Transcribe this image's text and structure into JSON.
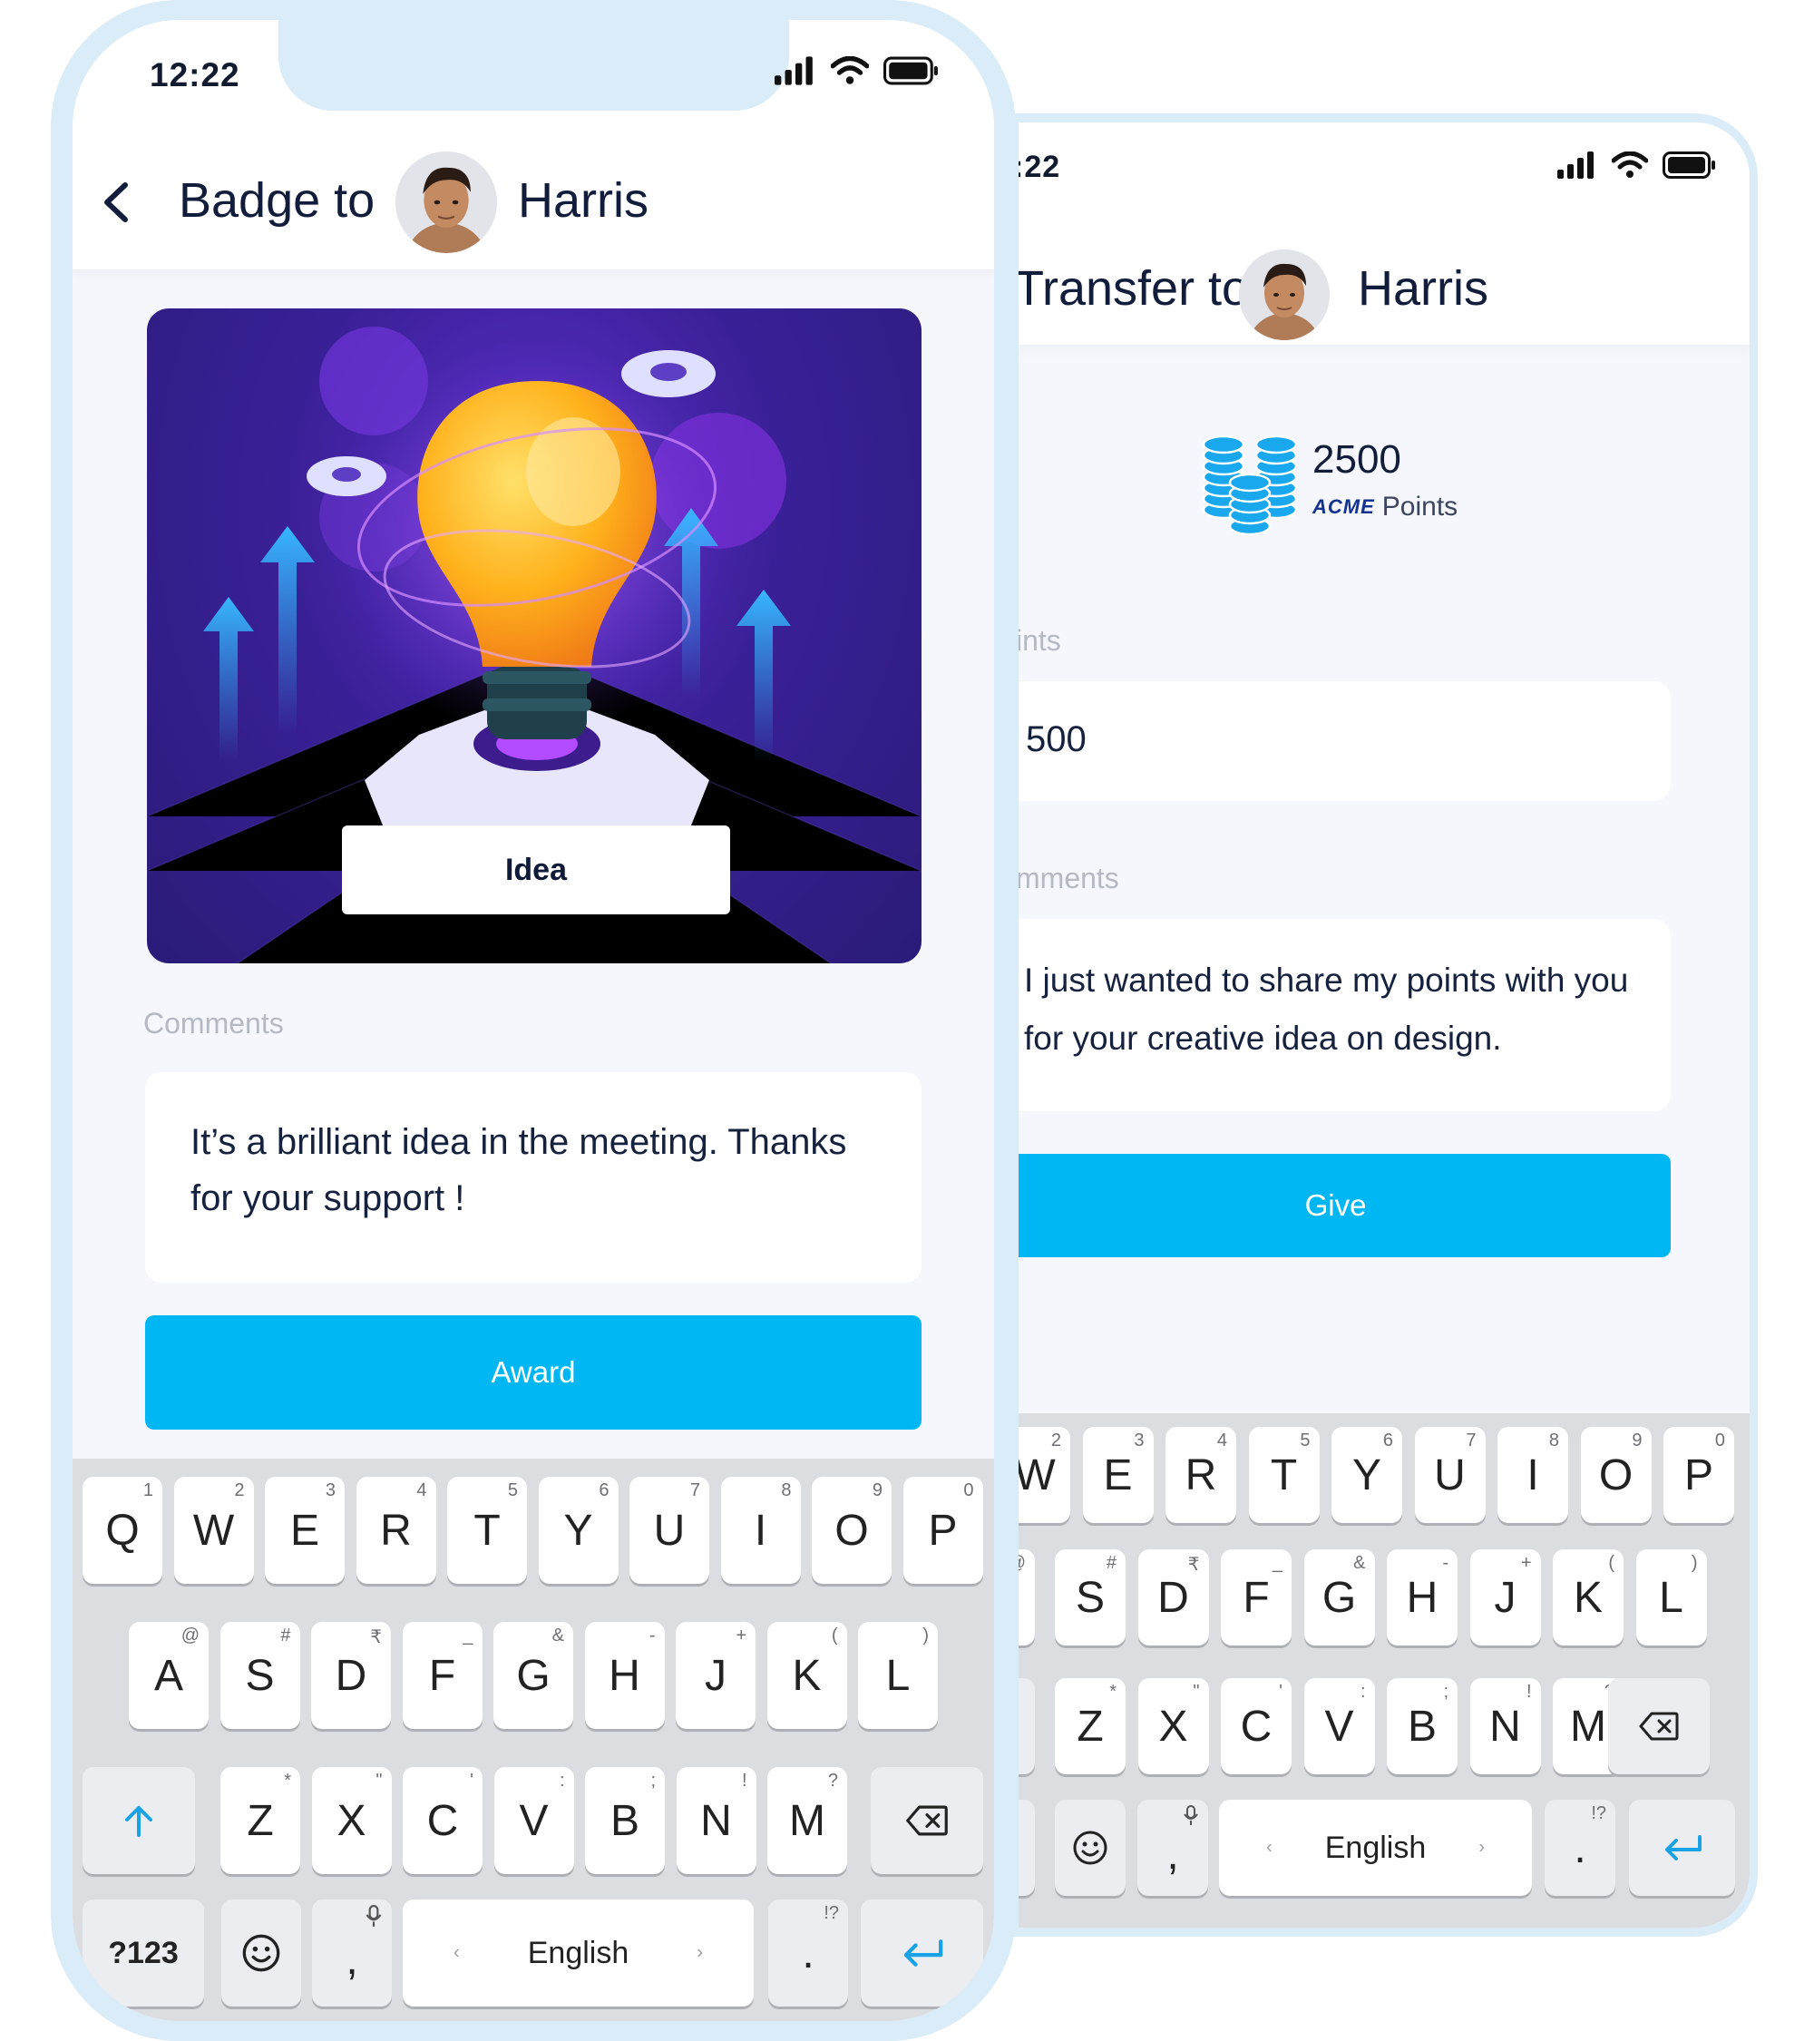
{
  "back_screen": {
    "status_time": ":22",
    "title": "Transfer to",
    "recipient_name": "Harris",
    "balance": {
      "amount": "2500",
      "brand": "ACME",
      "unit": "Points"
    },
    "points_label": "ints",
    "points_value": "500",
    "comments_label": "mments",
    "comment_lines": [
      "I just wanted to share my points with you",
      "for  your creative idea on design."
    ],
    "give_label": "Give",
    "keyboard": {
      "row1": [
        {
          "k": "W",
          "h": "2"
        },
        {
          "k": "E",
          "h": "3"
        },
        {
          "k": "R",
          "h": "4"
        },
        {
          "k": "T",
          "h": "5"
        },
        {
          "k": "Y",
          "h": "6"
        },
        {
          "k": "U",
          "h": "7"
        },
        {
          "k": "I",
          "h": "8"
        },
        {
          "k": "O",
          "h": "9"
        },
        {
          "k": "P",
          "h": "0"
        }
      ],
      "row2": [
        {
          "k": "S",
          "h": "#"
        },
        {
          "k": "D",
          "h": "₹"
        },
        {
          "k": "F",
          "h": "_"
        },
        {
          "k": "G",
          "h": "&"
        },
        {
          "k": "H",
          "h": "-"
        },
        {
          "k": "J",
          "h": "+"
        },
        {
          "k": "K",
          "h": "("
        },
        {
          "k": "L",
          "h": ")"
        }
      ],
      "row2_partial_hint": "@",
      "row3": [
        {
          "k": "Z",
          "h": "*"
        },
        {
          "k": "X",
          "h": "\""
        },
        {
          "k": "C",
          "h": "'"
        },
        {
          "k": "V",
          "h": ":"
        },
        {
          "k": "B",
          "h": ";"
        },
        {
          "k": "N",
          "h": "!"
        },
        {
          "k": "M",
          "h": "?"
        }
      ],
      "comma": ",",
      "period": ".",
      "period_hint": "!?",
      "space_label": "English"
    }
  },
  "front_screen": {
    "status_time": "12:22",
    "title": "Badge to",
    "recipient_name": "Harris",
    "badge_name": "Idea",
    "comments_label": "Comments",
    "comment_lines": [
      "It’s a brilliant idea in the meeting. Thanks",
      "for your support !"
    ],
    "award_label": "Award",
    "keyboard": {
      "row1": [
        {
          "k": "Q",
          "h": "1"
        },
        {
          "k": "W",
          "h": "2"
        },
        {
          "k": "E",
          "h": "3"
        },
        {
          "k": "R",
          "h": "4"
        },
        {
          "k": "T",
          "h": "5"
        },
        {
          "k": "Y",
          "h": "6"
        },
        {
          "k": "U",
          "h": "7"
        },
        {
          "k": "I",
          "h": "8"
        },
        {
          "k": "O",
          "h": "9"
        },
        {
          "k": "P",
          "h": "0"
        }
      ],
      "row2": [
        {
          "k": "A",
          "h": "@"
        },
        {
          "k": "S",
          "h": "#"
        },
        {
          "k": "D",
          "h": "₹"
        },
        {
          "k": "F",
          "h": "_"
        },
        {
          "k": "G",
          "h": "&"
        },
        {
          "k": "H",
          "h": "-"
        },
        {
          "k": "J",
          "h": "+"
        },
        {
          "k": "K",
          "h": "("
        },
        {
          "k": "L",
          "h": ")"
        }
      ],
      "row3": [
        {
          "k": "Z",
          "h": "*"
        },
        {
          "k": "X",
          "h": "\""
        },
        {
          "k": "C",
          "h": "'"
        },
        {
          "k": "V",
          "h": ":"
        },
        {
          "k": "B",
          "h": ";"
        },
        {
          "k": "N",
          "h": "!"
        },
        {
          "k": "M",
          "h": "?"
        }
      ],
      "numbers_label": "?123",
      "comma": ",",
      "period": ".",
      "period_hint": "!?",
      "space_label": "English"
    }
  },
  "colors": {
    "accent": "#00b7f4",
    "frame": "#d9ecf8",
    "screen_bg": "#f6f7fc",
    "keyboard_bg": "#dcdde1",
    "badge_bg": "#3a2097",
    "text_dark": "#121d3b",
    "label_gray": "#b5b9c4"
  },
  "icons": [
    "back-chevron-icon",
    "signal-icon",
    "wifi-icon",
    "battery-icon",
    "coins-icon",
    "acme-logo",
    "lightbulb-illustration",
    "gear-icon",
    "shift-icon",
    "backspace-icon",
    "emoji-icon",
    "mic-icon",
    "return-icon"
  ]
}
